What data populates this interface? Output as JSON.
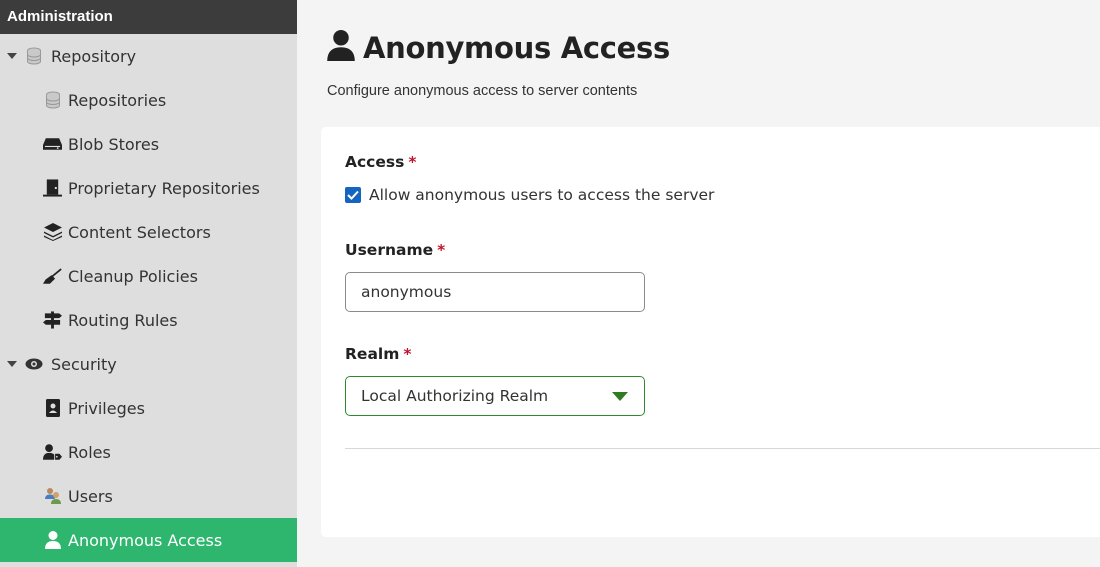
{
  "sidebar": {
    "header": "Administration",
    "groups": [
      {
        "label": "Repository",
        "icon": "database-icon",
        "expanded": true,
        "items": [
          {
            "label": "Repositories",
            "icon": "database-icon"
          },
          {
            "label": "Blob Stores",
            "icon": "hdd-icon"
          },
          {
            "label": "Proprietary Repositories",
            "icon": "door-icon"
          },
          {
            "label": "Content Selectors",
            "icon": "layers-icon"
          },
          {
            "label": "Cleanup Policies",
            "icon": "broom-icon"
          },
          {
            "label": "Routing Rules",
            "icon": "signpost-icon"
          }
        ]
      },
      {
        "label": "Security",
        "icon": "eye-icon",
        "expanded": true,
        "items": [
          {
            "label": "Privileges",
            "icon": "id-badge-icon"
          },
          {
            "label": "Roles",
            "icon": "user-tag-icon"
          },
          {
            "label": "Users",
            "icon": "users-icon"
          },
          {
            "label": "Anonymous Access",
            "icon": "user-icon",
            "active": true
          }
        ]
      }
    ]
  },
  "page": {
    "title": "Anonymous Access",
    "description": "Configure anonymous access to server contents"
  },
  "form": {
    "access_label": "Access",
    "access_checkbox_label": "Allow anonymous users to access the server",
    "access_checked": true,
    "username_label": "Username",
    "username_value": "anonymous",
    "realm_label": "Realm",
    "realm_value": "Local Authorizing Realm",
    "required_marker": "*"
  },
  "colors": {
    "active_nav": "#2eb66f",
    "required": "#c4142d",
    "checkbox": "#1565c0",
    "select_border": "#2f8a2f"
  }
}
